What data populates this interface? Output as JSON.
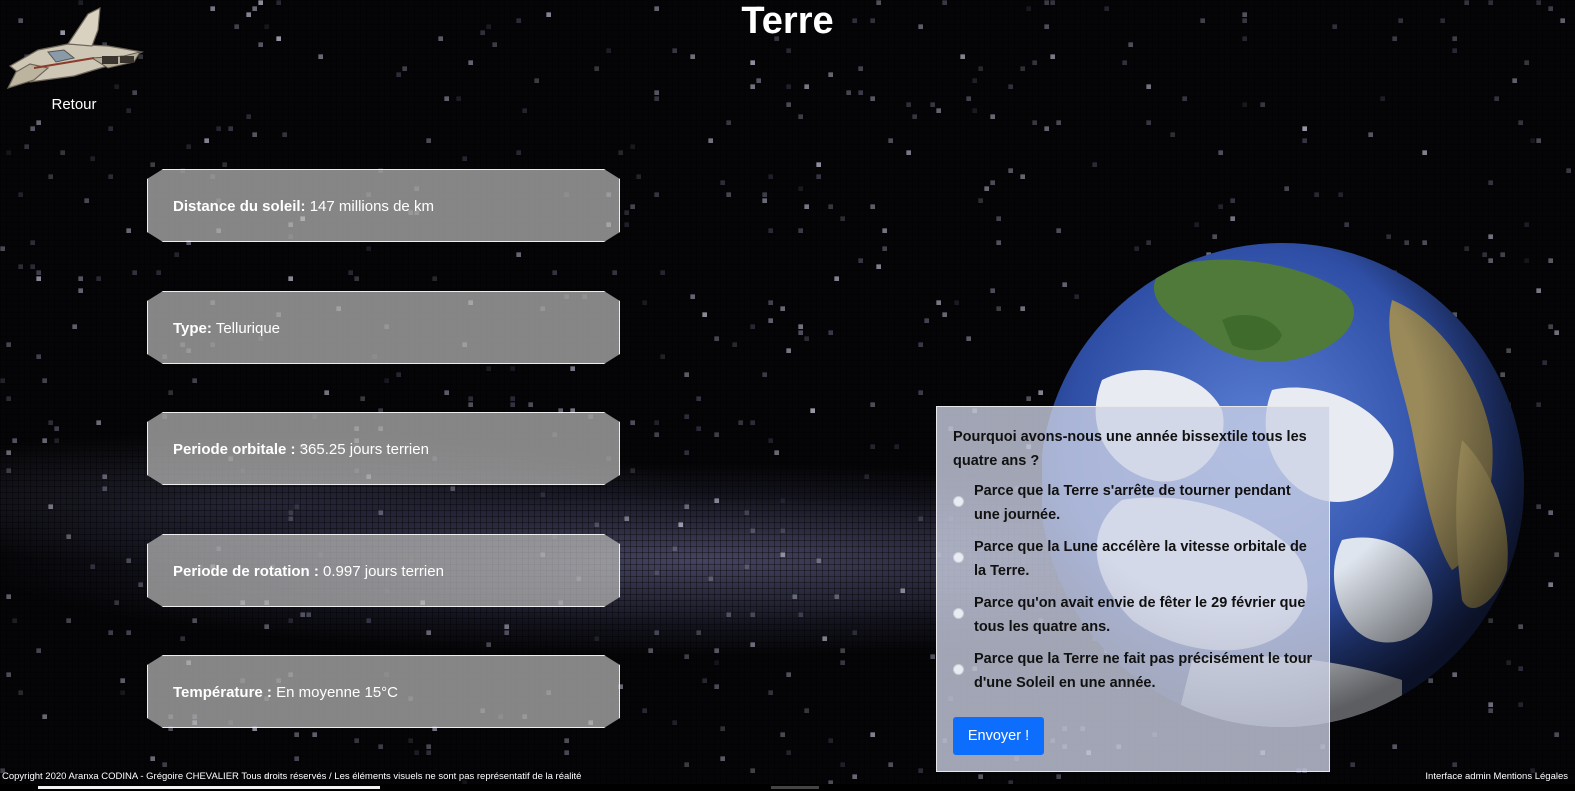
{
  "page": {
    "title": "Terre",
    "back_label": "Retour"
  },
  "info_cards": [
    {
      "label": "Distance du soleil:",
      "value": "147 millions de km"
    },
    {
      "label": "Type:",
      "value": "Tellurique"
    },
    {
      "label": "Periode orbitale :",
      "value": "365.25 jours terrien"
    },
    {
      "label": "Periode de rotation :",
      "value": "0.997 jours terrien"
    },
    {
      "label": "Température :",
      "value": "En moyenne 15°C"
    }
  ],
  "quiz": {
    "question": "Pourquoi avons-nous une année bissextile tous les quatre ans ?",
    "options": [
      "Parce que la Terre s'arrête de tourner pendant une journée.",
      "Parce que la Lune accélère la vitesse orbitale de la Terre.",
      "Parce qu'on avait envie de fêter le 29 février que tous les quatre ans.",
      "Parce que la Terre ne fait pas précisément le tour d'une Soleil en une année."
    ],
    "submit_label": "Envoyer !"
  },
  "footer": {
    "copyright": "Copyright 2020 Aranxa CODINA - Grégoire CHEVALIER Tous droits réservés / Les éléments visuels ne sont pas représentatif de la réalité",
    "admin_link": "Interface admin",
    "legal_link": "Mentions Légales"
  },
  "colors": {
    "submit_button": "#0d6efd",
    "card_background": "#b9b9b9",
    "quiz_background": "#cdd2e6"
  },
  "icons": {
    "back": "spaceship-icon",
    "planet": "earth-image"
  }
}
